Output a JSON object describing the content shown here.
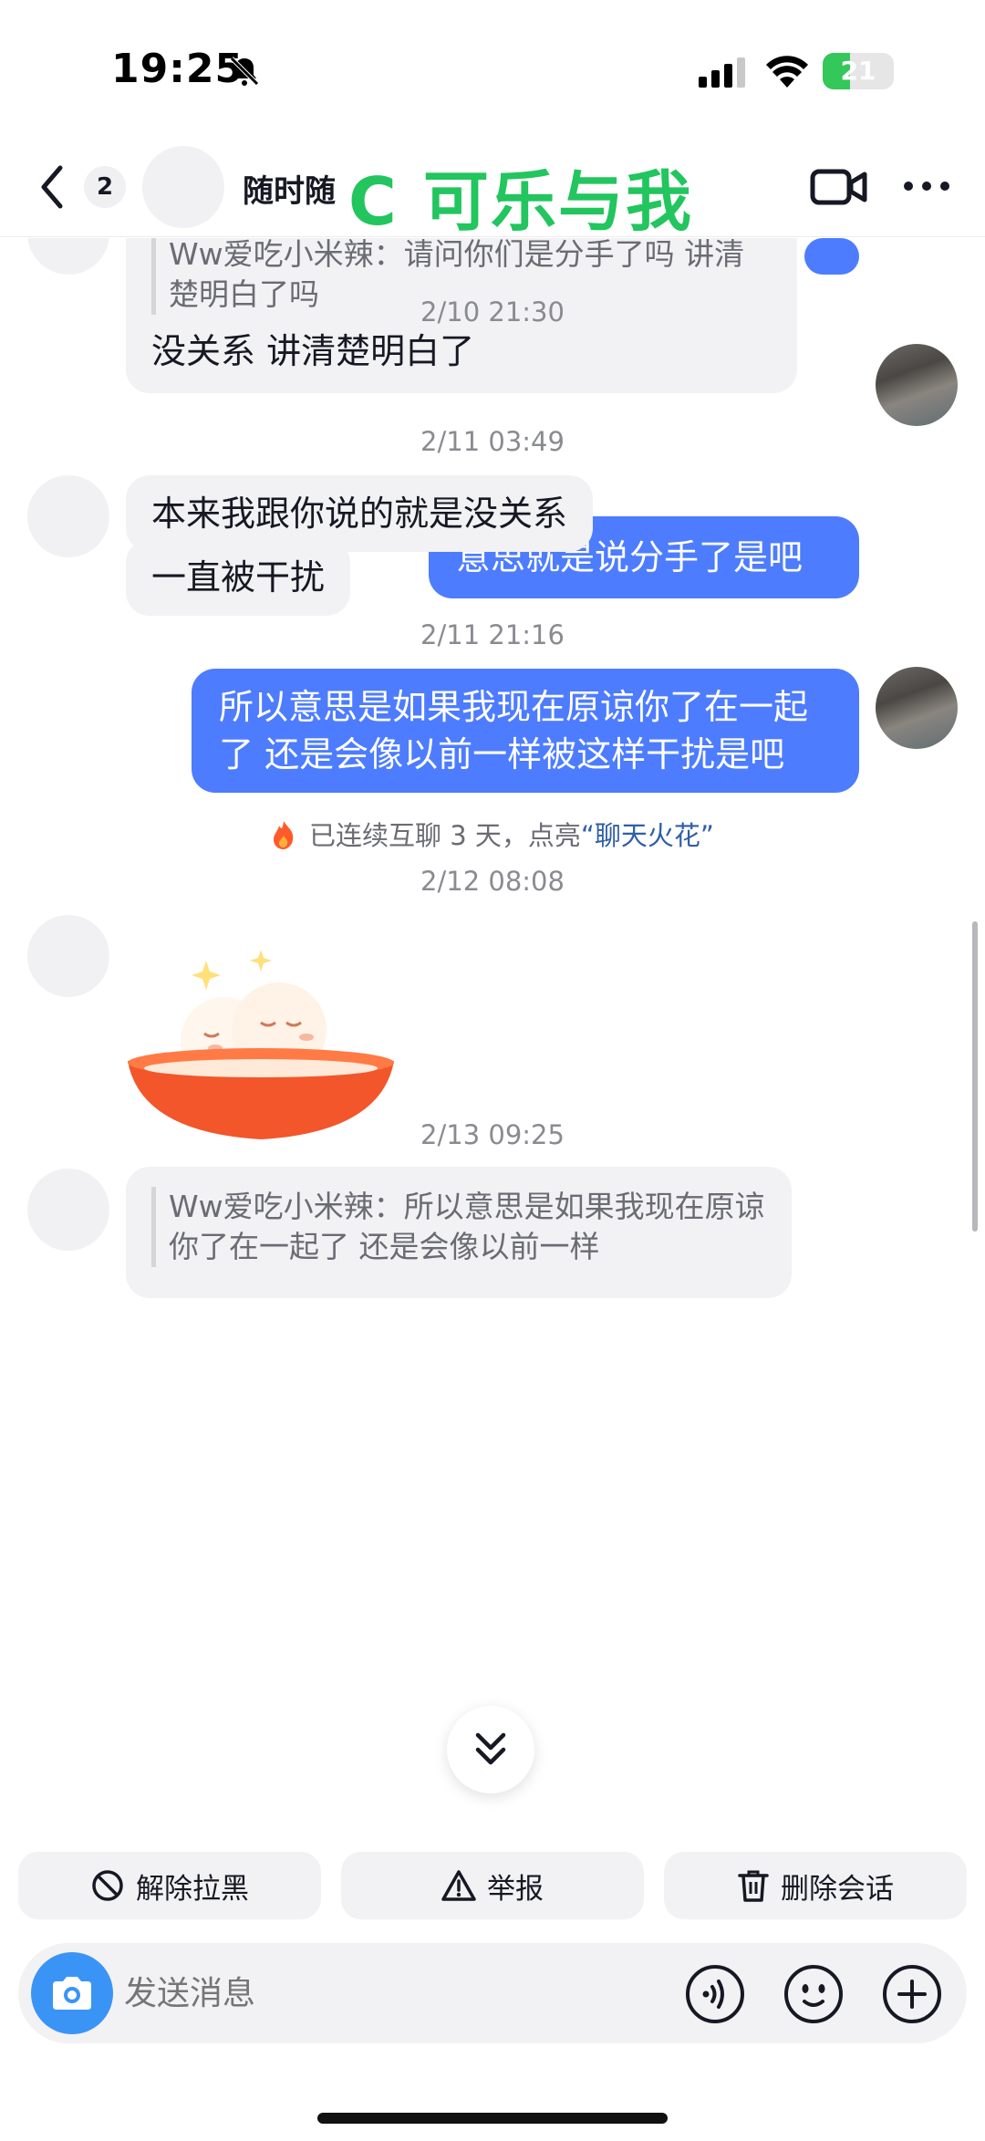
{
  "status_bar": {
    "time": "19:25",
    "battery": "21",
    "battery_fraction": 0.21
  },
  "header": {
    "unread_count": "2",
    "contact_name": "随时随",
    "overlay_text": "C 可乐与我"
  },
  "messages": {
    "m1": {
      "quote": "Ww爱吃小米辣：请问你们是分手了吗 讲清楚明白了吗",
      "text": "没关系  讲清楚明白了"
    },
    "t1": "2/10 21:30",
    "m2": "意思就是说分手了是吧",
    "t2": "2/11 03:49",
    "m3": "本来我跟你说的就是没关系",
    "m4": "一直被干扰",
    "t3": "2/11 21:16",
    "m5": "所以意思是如果我现在原谅你了在一起了 还是会像以前一样被这样干扰是吧",
    "streak_prefix": "已连续互聊 3 天，点亮",
    "streak_link": "“聊天火花”",
    "t4": "2/12 08:08",
    "t5": "2/13 09:25",
    "m6": {
      "quote": "Ww爱吃小米辣：所以意思是如果我现在原谅你了在一起了 还是会像以前一样"
    }
  },
  "actions": {
    "unblock": "解除拉黑",
    "report": "举报",
    "delete": "删除会话"
  },
  "composer": {
    "placeholder": "发送消息"
  },
  "colors": {
    "outgoing_bubble": "#4d7cff",
    "incoming_bubble": "#f2f2f4",
    "overlay_green": "#22c55e",
    "link": "#2f5fa8",
    "camera": "#3a94f5"
  }
}
